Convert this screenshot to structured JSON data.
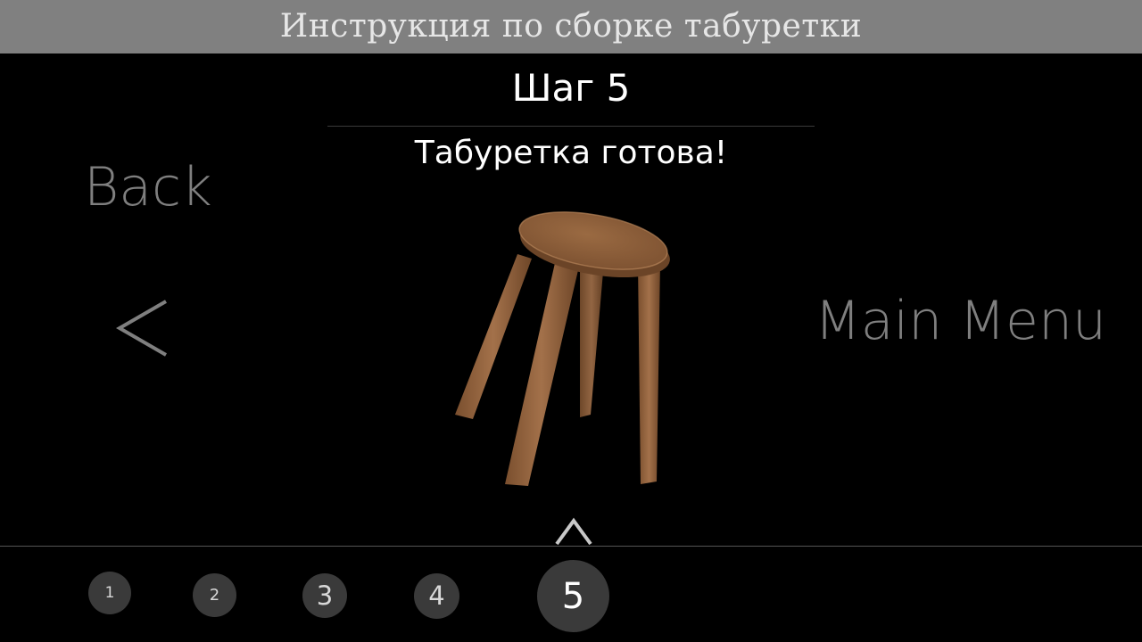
{
  "header": {
    "title": "Инструкция по сборке табуретки"
  },
  "step": {
    "title": "Шаг 5",
    "description": "Табуретка готова!"
  },
  "navigation": {
    "back_label": "Back",
    "back_arrow_icon": "chevron-left-icon",
    "main_menu_label": "Main Menu",
    "up_icon": "chevron-up-icon"
  },
  "steps": {
    "items": [
      "1",
      "2",
      "3",
      "4",
      "5"
    ],
    "current": "5"
  },
  "colors": {
    "background": "#000000",
    "title_bar": "#808080",
    "title_text": "#e6e6e6",
    "muted_text": "#7f7f7f",
    "bubble": "#3a3a3a",
    "wood": "#9b6a43"
  }
}
